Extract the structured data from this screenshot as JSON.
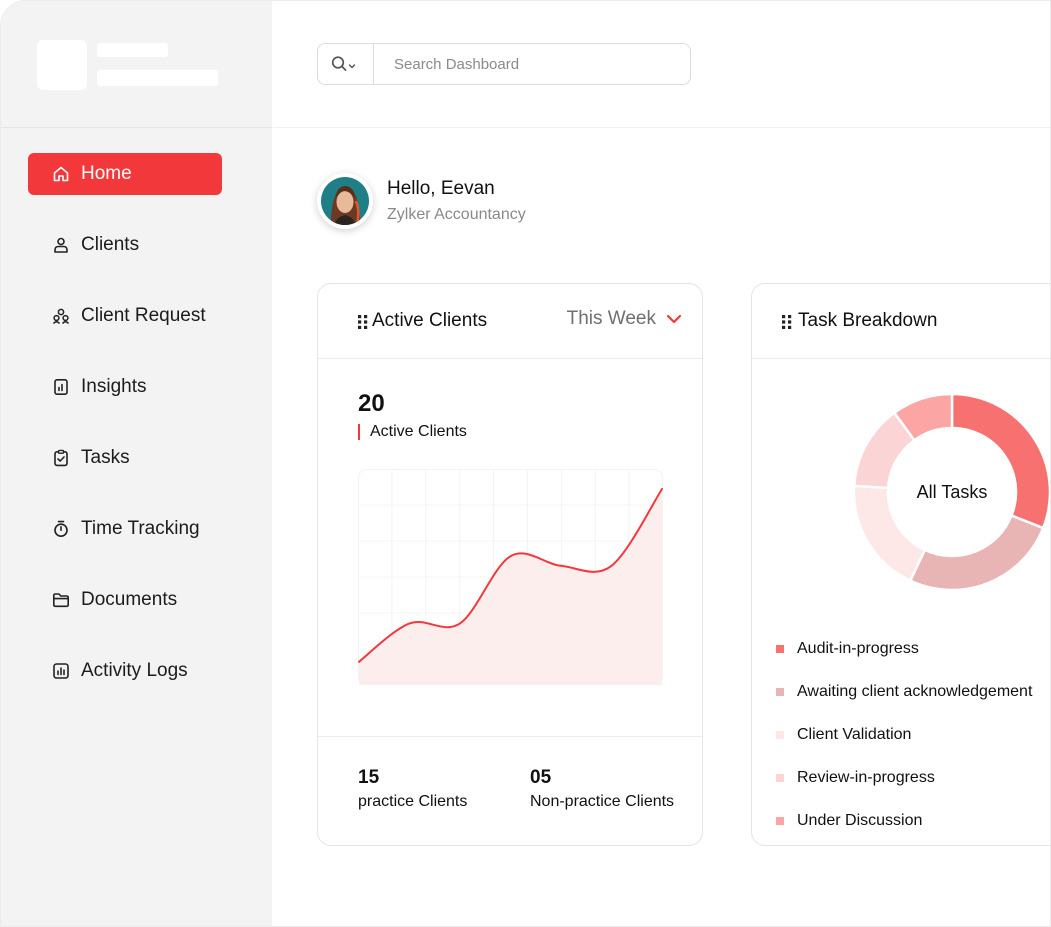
{
  "search": {
    "placeholder": "Search Dashboard"
  },
  "sidebar": {
    "items": [
      {
        "label": "Home",
        "icon": "home-icon",
        "active": true
      },
      {
        "label": "Clients",
        "icon": "user-icon"
      },
      {
        "label": "Client Request",
        "icon": "users-group-icon"
      },
      {
        "label": "Insights",
        "icon": "report-icon"
      },
      {
        "label": "Tasks",
        "icon": "clipboard-check-icon"
      },
      {
        "label": "Time Tracking",
        "icon": "stopwatch-icon"
      },
      {
        "label": "Documents",
        "icon": "folder-icon"
      },
      {
        "label": "Activity Logs",
        "icon": "activity-chart-icon"
      }
    ]
  },
  "profile": {
    "greeting": "Hello, Eevan",
    "company": "Zylker Accountancy"
  },
  "active_clients": {
    "title": "Active Clients",
    "period": "This Week",
    "count": "20",
    "count_label": "Active Clients",
    "practice_count": "15",
    "practice_label": "practice Clients",
    "non_practice_count": "05",
    "non_practice_label": "Non-practice Clients"
  },
  "task_breakdown": {
    "title": "Task Breakdown",
    "center_label": "All Tasks",
    "legend": [
      {
        "label": "Audit-in-progress",
        "color": "#f87171"
      },
      {
        "label": "Awaiting client acknowledgement",
        "color": "#e9b4b4"
      },
      {
        "label": "Client Validation",
        "color": "#fde7e7"
      },
      {
        "label": "Review-in-progress",
        "color": "#fbd5d5"
      },
      {
        "label": "Under Discussion",
        "color": "#fca5a5"
      }
    ]
  },
  "colors": {
    "accent": "#f3383b",
    "chart_fill": "#fdeeee"
  },
  "chart_data": [
    {
      "type": "area",
      "title": "",
      "x": [
        0,
        1,
        2,
        3,
        4,
        5,
        6
      ],
      "values": [
        2,
        6,
        6,
        13,
        12,
        12,
        20
      ],
      "ylim": [
        0,
        20
      ],
      "grid": true,
      "color": "#f3383b"
    },
    {
      "type": "pie",
      "categories": [
        "Audit-in-progress",
        "Awaiting client acknowledgement",
        "Client Validation",
        "Review-in-progress",
        "Under Discussion"
      ],
      "values": [
        31,
        26,
        19,
        14,
        10
      ],
      "center_label": "All Tasks"
    }
  ]
}
